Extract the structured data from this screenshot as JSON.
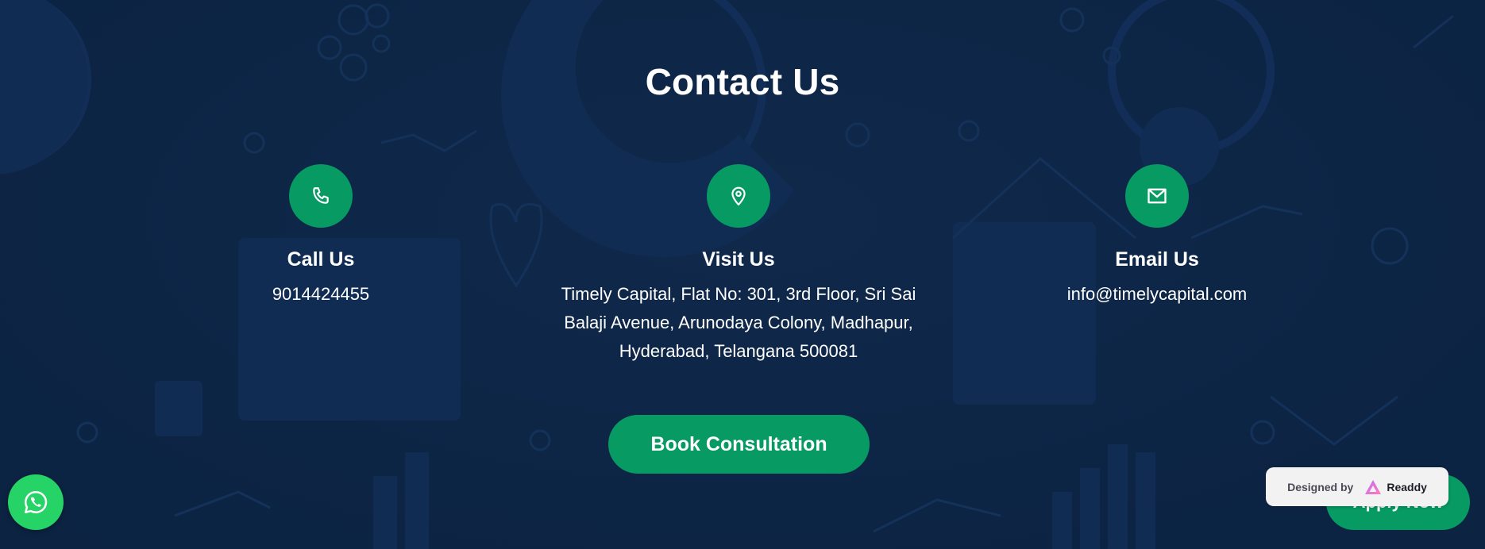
{
  "section": {
    "title": "Contact Us"
  },
  "contacts": [
    {
      "icon": "phone-icon",
      "title": "Call Us",
      "text": "9014424455"
    },
    {
      "icon": "map-pin-icon",
      "title": "Visit Us",
      "text": "Timely Capital, Flat No: 301, 3rd Floor, Sri Sai Balaji Avenue, Arunodaya Colony, Madhapur, Hyderabad, Telangana 500081"
    },
    {
      "icon": "mail-icon",
      "title": "Email Us",
      "text": "info@timelycapital.com"
    }
  ],
  "cta": {
    "book_label": "Book Consultation"
  },
  "floating": {
    "whatsapp_icon": "whatsapp-icon",
    "apply_label": "Apply Now"
  },
  "badge": {
    "designed_by": "Designed by",
    "brand": "Readdy"
  },
  "colors": {
    "background": "#0f2747",
    "accent": "#079a63",
    "whatsapp": "#25d366"
  }
}
